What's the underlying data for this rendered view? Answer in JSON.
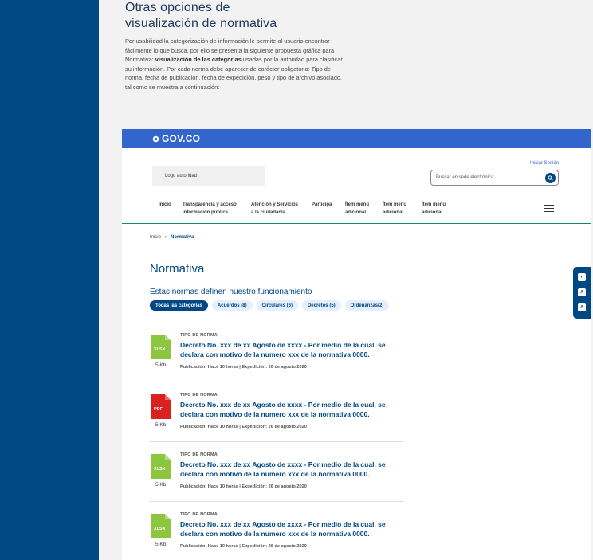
{
  "intro": {
    "title_line1": "Otras opciones de",
    "title_line2": "visualización de normativa",
    "body_a": "Por usabilidad la categorización de información le permite al usuario encontrar fácilmente lo que busca, por ello se presenta la siguiente propuesta gráfica para Normativa: ",
    "body_bold": "visualización de las categorías",
    "body_b": " usadas por la autoridad para clasificar su información. Por cada norma debe aparecer de carácter obligatorio: Tipo de norma, fecha de publicación, fecha de expedición, peso y tipo de archivo asociado, tal como se muestra a continuación:"
  },
  "govbar": {
    "brand": "GOV.CO"
  },
  "header": {
    "logo_placeholder": "Logo autoridad",
    "login": "Iniciar Sesión",
    "search_placeholder": "Buscar en sede electrónica"
  },
  "nav": {
    "items": [
      {
        "l1": "Inicio",
        "l2": ""
      },
      {
        "l1": "Transparencia y acceso",
        "l2": "información pública"
      },
      {
        "l1": "Atención y Servicios",
        "l2": "a la ciudadanía"
      },
      {
        "l1": "Participa",
        "l2": ""
      },
      {
        "l1": "Ítem menú",
        "l2": "adicional"
      },
      {
        "l1": "Ítem menú",
        "l2": "adicional"
      },
      {
        "l1": "Ítem menú",
        "l2": "adicional"
      }
    ]
  },
  "breadcrumb": {
    "home": "Inicio",
    "sep": "›",
    "current": "Normativa"
  },
  "main": {
    "title": "Normativa",
    "subtitle": "Estas normas definen nuestro funcionamiento",
    "chips": [
      "Todas las categorías",
      "Acuerdos (8)",
      "Circulares (6)",
      "Decretos (5)",
      "Ordenanzas(2)"
    ]
  },
  "norms": [
    {
      "file_type": "XLSX",
      "file_color": "#8cc63f",
      "size": "5 Kb",
      "type_label": "TIPO DE NORMA",
      "title": "Decreto No. xxx de xx Agosto de xxxx - Por medio de la cual, se declara con motivo de la numero xxx de la normativa 0000.",
      "meta": "Publicación: Hace 10 horas | Expedición: 26 de agosto 2020"
    },
    {
      "file_type": "PDF",
      "file_color": "#d9211f",
      "size": "5 Kb",
      "type_label": "TIPO DE NORMA",
      "title": "Decreto No. xxx de xx Agosto de xxxx - Por medio de la cual, se declara con motivo de la numero xxx de la normativa 0000.",
      "meta": "Publicación: Hace 10 horas | Expedición: 26 de agosto 2020"
    },
    {
      "file_type": "XLSX",
      "file_color": "#8cc63f",
      "size": "5 Kb",
      "type_label": "TIPO DE NORMA",
      "title": "Decreto No. xxx de xx Agosto de xxxx - Por medio de la cual, se declara con motivo de la numero xxx de la normativa 0000.",
      "meta": "Publicación: Hace 10 horas | Expedición: 26 de agosto 2020"
    },
    {
      "file_type": "XLSX",
      "file_color": "#8cc63f",
      "size": "5 Kb",
      "type_label": "TIPO DE NORMA",
      "title": "Decreto No. xxx de xx Agosto de xxxx - Por medio de la cual, se declara con motivo de la numero xxx de la normativa 0000.",
      "meta": "Publicación: Hace 10 horas | Expedición: 26 de agosto 2020"
    }
  ],
  "accessibility": {
    "buttons": [
      "contrast-icon",
      "text-smaller-icon",
      "text-larger-icon"
    ],
    "labels": [
      "◐",
      "A",
      "A"
    ]
  },
  "colors": {
    "primary": "#004884",
    "govbar": "#3366cc",
    "accent_line": "#069169"
  }
}
